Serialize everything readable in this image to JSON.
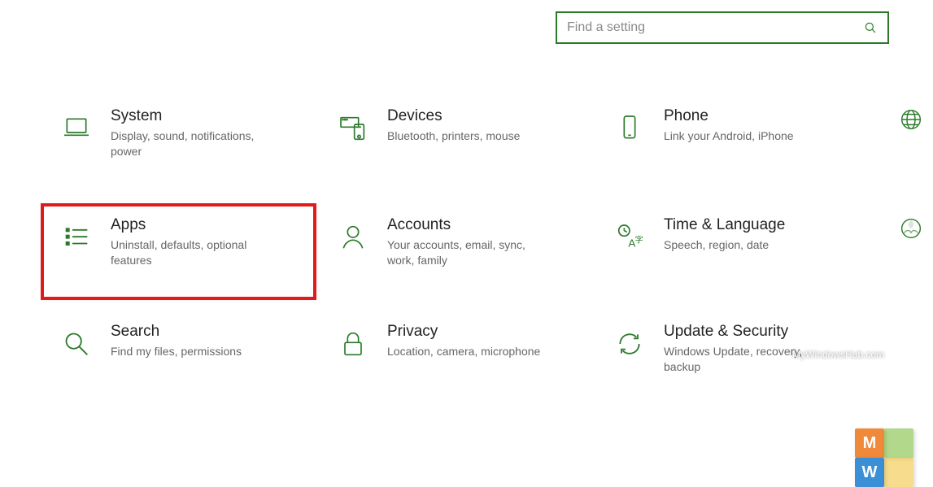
{
  "search": {
    "placeholder": "Find a setting"
  },
  "tiles": [
    {
      "key": "system",
      "title": "System",
      "desc": "Display, sound, notifications, power"
    },
    {
      "key": "devices",
      "title": "Devices",
      "desc": "Bluetooth, printers, mouse"
    },
    {
      "key": "phone",
      "title": "Phone",
      "desc": "Link your Android, iPhone"
    },
    {
      "key": "apps",
      "title": "Apps",
      "desc": "Uninstall, defaults, optional features"
    },
    {
      "key": "accounts",
      "title": "Accounts",
      "desc": "Your accounts, email, sync, work, family"
    },
    {
      "key": "timelang",
      "title": "Time & Language",
      "desc": "Speech, region, date"
    },
    {
      "key": "search",
      "title": "Search",
      "desc": "Find my files, permissions"
    },
    {
      "key": "privacy",
      "title": "Privacy",
      "desc": "Location, camera, microphone"
    },
    {
      "key": "update",
      "title": "Update & Security",
      "desc": "Windows Update, recovery, backup"
    }
  ],
  "watermark": "MyWindowsHub.com",
  "highlighted": "apps"
}
